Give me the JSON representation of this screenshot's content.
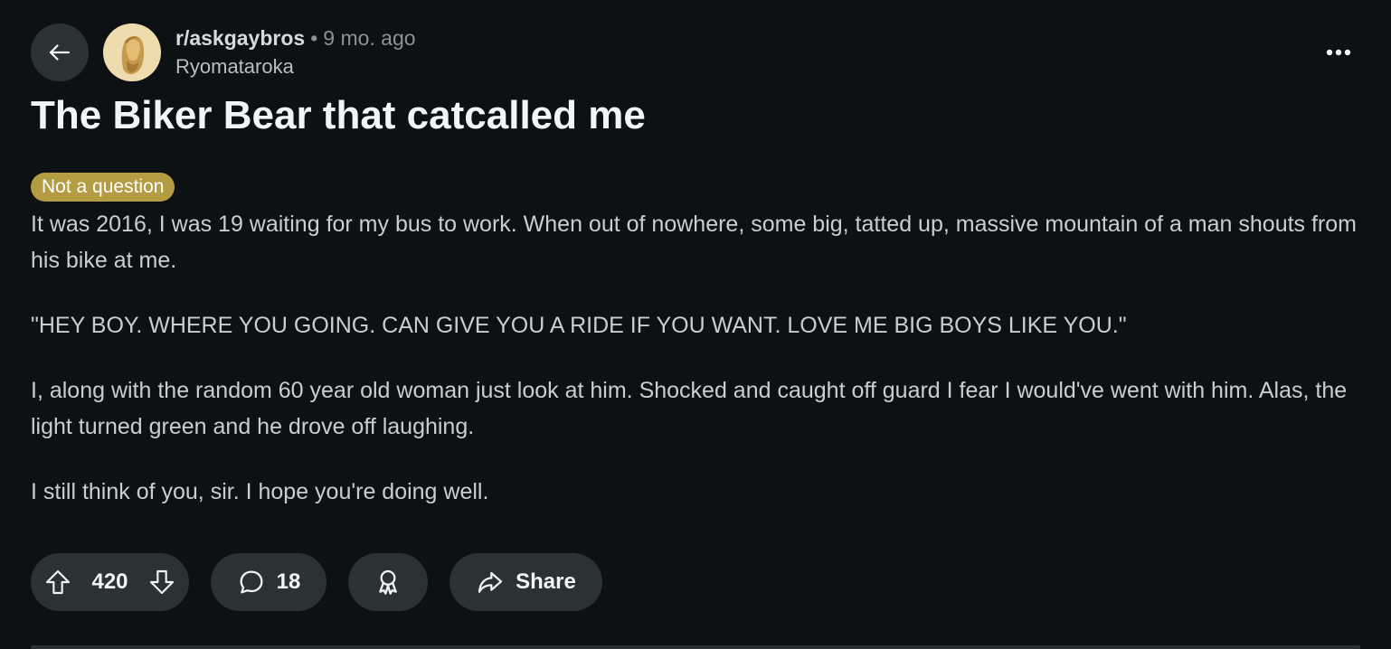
{
  "post": {
    "subreddit": "r/askgaybros",
    "separator": "•",
    "time_ago": "9 mo. ago",
    "author": "Ryomataroka",
    "title": "The Biker Bear that catcalled me",
    "flair": "Not a question",
    "body": [
      "It was 2016, I was 19 waiting for my bus to work. When out of nowhere, some big, tatted up, massive mountain of a man shouts from his bike at me.",
      "\"HEY BOY. WHERE YOU GOING. CAN GIVE YOU A RIDE IF YOU WANT. LOVE ME BIG BOYS LIKE YOU.\"",
      "I, along with the random 60 year old woman just look at him. Shocked and caught off guard I fear I would've went with him. Alas, the light turned green and he drove off laughing.",
      "I still think of you, sir. I hope you're doing well."
    ]
  },
  "actions": {
    "vote_count": "420",
    "comment_count": "18",
    "share_label": "Share"
  },
  "icons": {
    "back": "arrow-left-icon",
    "more": "more-horizontal-icon",
    "upvote": "upvote-arrow-icon",
    "downvote": "downvote-arrow-icon",
    "comment": "comment-bubble-icon",
    "award": "award-icon",
    "share": "share-arrow-icon"
  },
  "colors": {
    "background": "#0e1113",
    "pill_background": "#2a3236",
    "flair_background": "#b49c42",
    "title": "#f2f4f5",
    "body_text": "#c9ced1",
    "muted": "#8b9296"
  }
}
